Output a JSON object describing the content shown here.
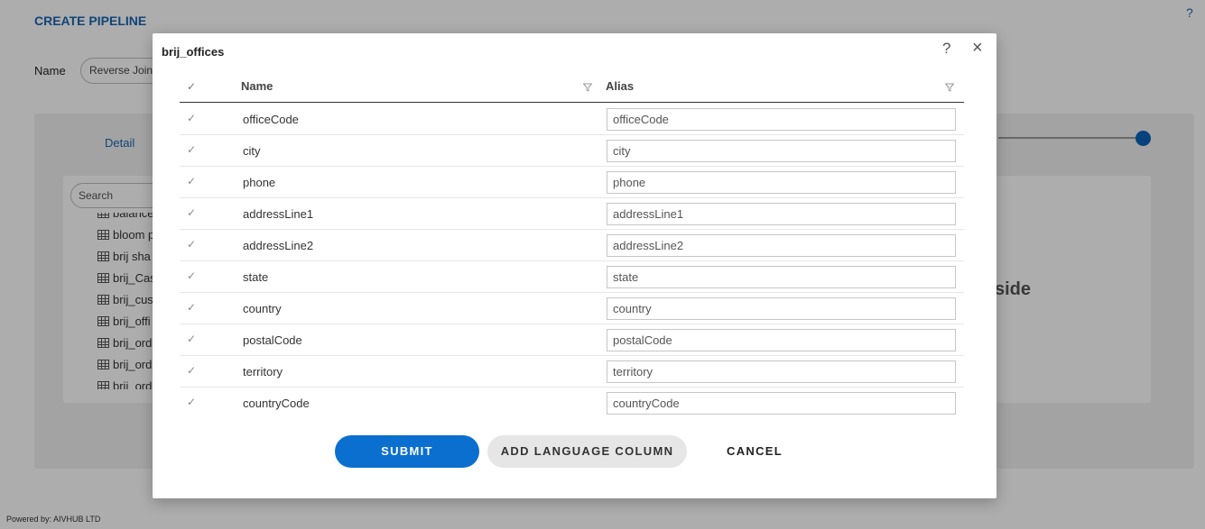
{
  "page": {
    "title": "CREATE PIPELINE",
    "help_icon": "?",
    "name_label": "Name",
    "name_value": "Reverse Join",
    "detail_tab": "Detail",
    "search_placeholder": "Search",
    "tree_items": [
      "balance",
      "bloom p",
      "brij sha",
      "brij_Cas",
      "brij_cus",
      "brij_offi",
      "brij_ord",
      "brij_ord",
      "brij_ord"
    ],
    "side_text": "side",
    "powered_by": "Powered by: AIVHUB LTD"
  },
  "modal": {
    "title": "brij_offices",
    "help_icon": "?",
    "close_icon": "×",
    "header": {
      "check_icon": "✓",
      "name_col": "Name",
      "alias_col": "Alias"
    },
    "rows": [
      {
        "name": "officeCode",
        "alias": "officeCode"
      },
      {
        "name": "city",
        "alias": "city"
      },
      {
        "name": "phone",
        "alias": "phone"
      },
      {
        "name": "addressLine1",
        "alias": "addressLine1"
      },
      {
        "name": "addressLine2",
        "alias": "addressLine2"
      },
      {
        "name": "state",
        "alias": "state"
      },
      {
        "name": "country",
        "alias": "country"
      },
      {
        "name": "postalCode",
        "alias": "postalCode"
      },
      {
        "name": "territory",
        "alias": "territory"
      },
      {
        "name": "countryCode",
        "alias": "countryCode"
      }
    ],
    "row_check_icon": "✓",
    "submit_label": "SUBMIT",
    "add_language_label": "ADD LANGUAGE COLUMN",
    "cancel_label": "CANCEL"
  },
  "colors": {
    "accent": "#0a6fcf",
    "link": "#1a66b3",
    "overlay": "rgba(0,0,0,0.32)"
  }
}
